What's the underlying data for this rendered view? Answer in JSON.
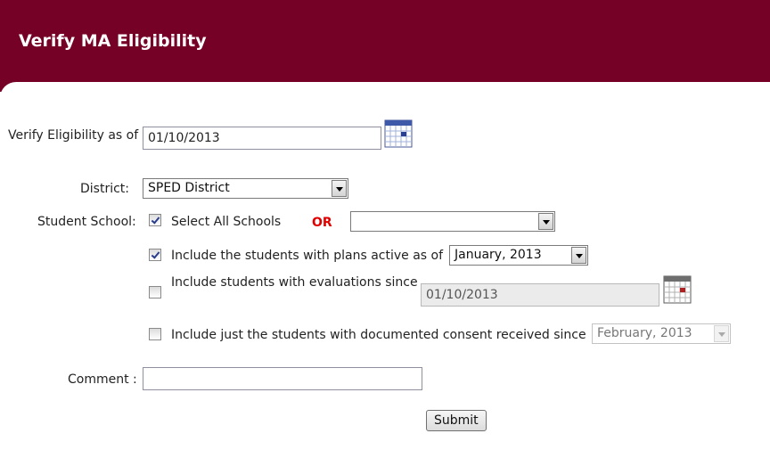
{
  "header": {
    "title": "Verify MA Eligibility"
  },
  "form": {
    "as_of": {
      "label": "Verify Eligibility as of",
      "value": "01/10/2013"
    },
    "district": {
      "label": "District:",
      "selected": "SPED District"
    },
    "school": {
      "label": "Student School:",
      "select_all_label": "Select All Schools",
      "select_all_checked": true,
      "or_label": "OR",
      "selected": ""
    },
    "plans_active": {
      "label": "Include the students with plans active as of",
      "checked": true,
      "selected": "January, 2013"
    },
    "evaluations": {
      "label": "Include students with evaluations since",
      "checked": false,
      "value": "01/10/2013"
    },
    "consent": {
      "label": "Include just the students with documented consent received since",
      "checked": false,
      "selected": "February, 2013"
    },
    "comment": {
      "label": "Comment :",
      "value": ""
    },
    "submit_label": "Submit"
  },
  "colors": {
    "header_bg": "#760126",
    "or_text": "#e00000"
  },
  "icons": {
    "calendar": "calendar-icon",
    "dropdown": "chevron-down-icon"
  }
}
